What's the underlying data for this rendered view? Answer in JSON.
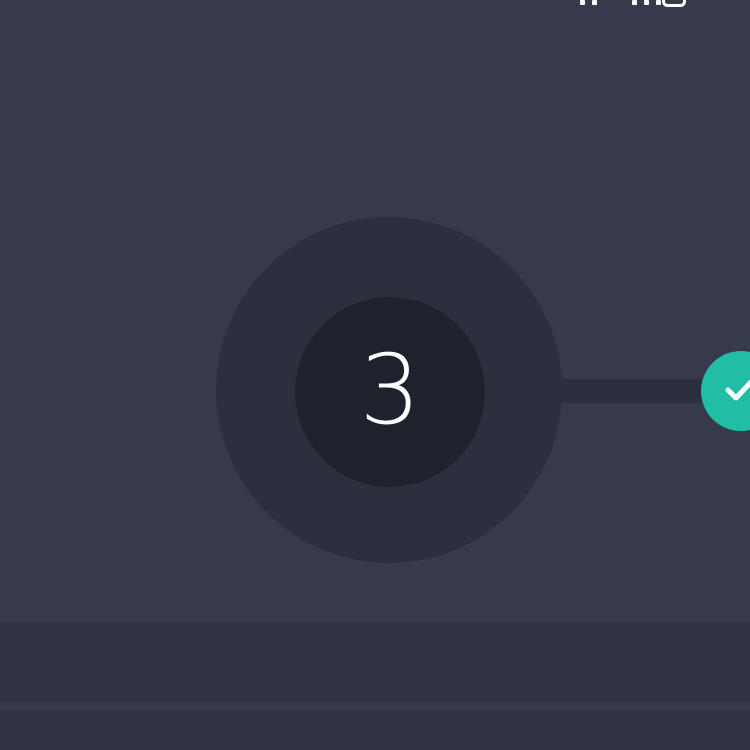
{
  "stepper": {
    "current_step": "3",
    "steps": [
      {
        "label": "3",
        "state": "current"
      },
      {
        "label": "",
        "state": "completed",
        "icon": "checkmark-icon"
      }
    ]
  },
  "colors": {
    "background": "#373a4b",
    "ring": "#2c2f3d",
    "current_step_fill": "#1f212c",
    "completed_step_fill": "#20bfa5",
    "text": "#ffffff",
    "band": "#303344"
  },
  "status_bar": {
    "icons": [
      "signal-icon",
      "wifi-icon"
    ]
  }
}
